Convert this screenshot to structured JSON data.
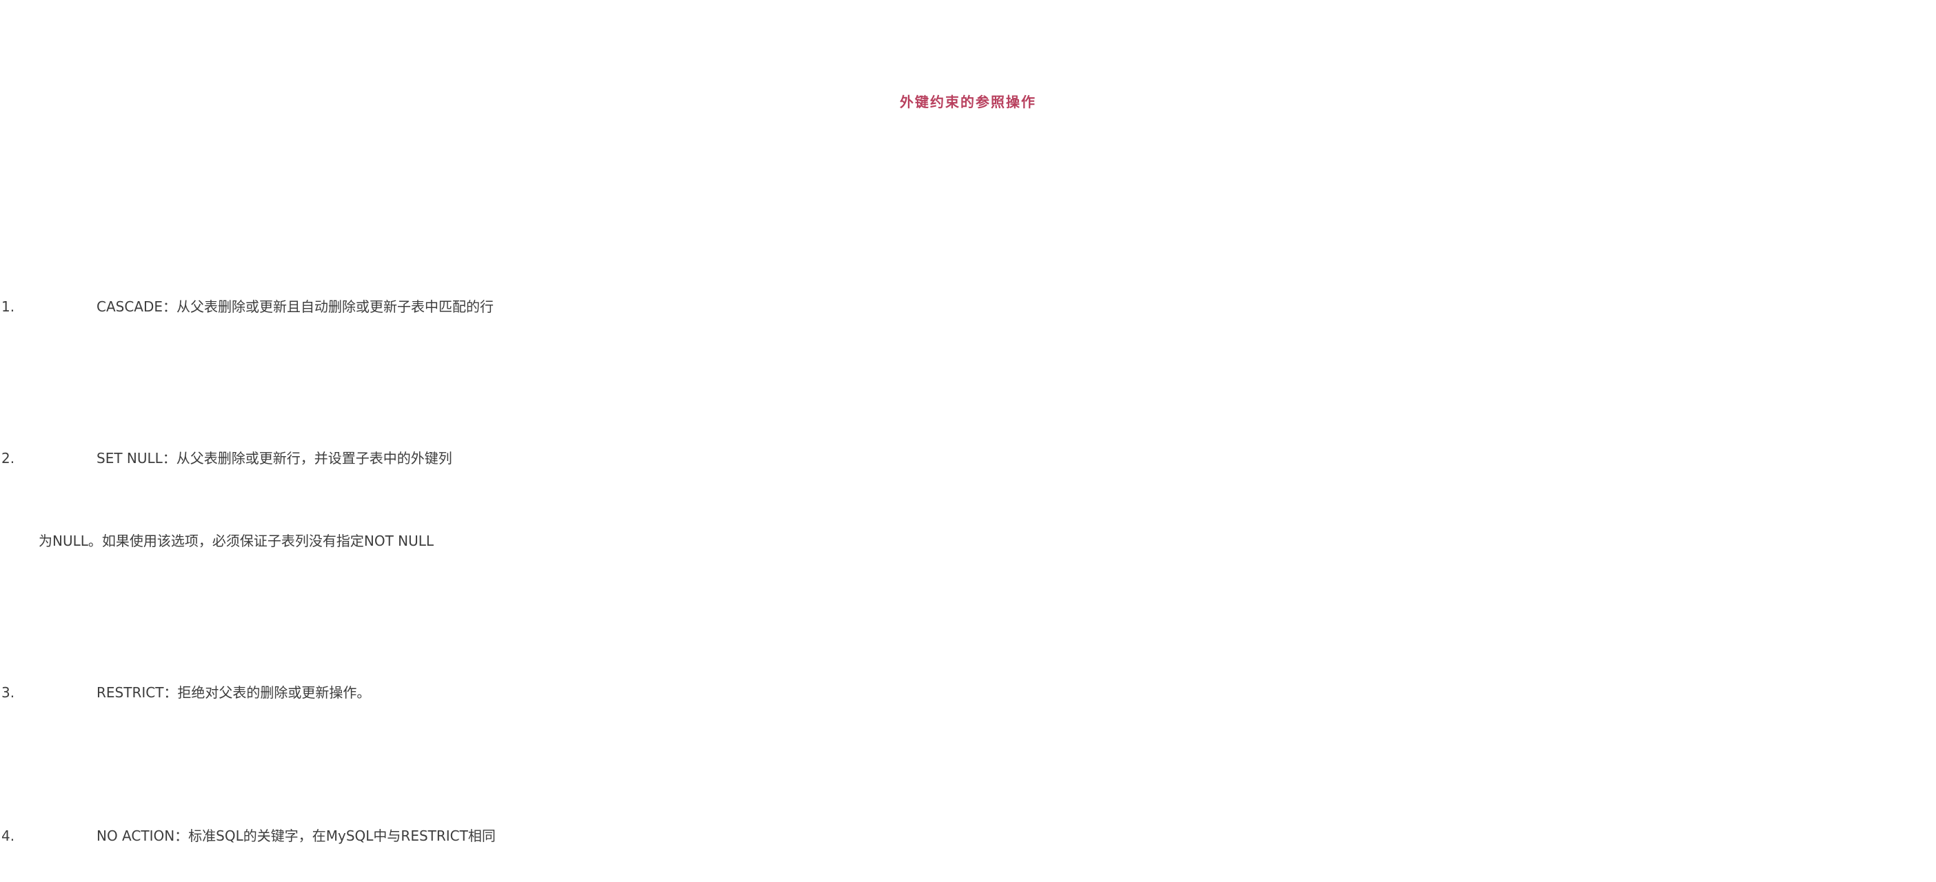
{
  "slide": {
    "title": "外键约束的参照操作",
    "items": [
      {
        "number": "1.",
        "line1": "CASCADE：从父表删除或更新且自动删除或更新子表中匹配的行"
      },
      {
        "number": "2.",
        "line1": "SET NULL：从父表删除或更新行，并设置子表中的外键列",
        "line2": "为NULL。如果使用该选项，必须保证子表列没有指定NOT NULL"
      },
      {
        "number": "3.",
        "line1": "RESTRICT：拒绝对父表的删除或更新操作。"
      },
      {
        "number": "4.",
        "line1": "NO ACTION：标准SQL的关键字，在MySQL中与RESTRICT相同"
      }
    ],
    "colors": {
      "title": "#b8405e",
      "body_text": "#3d3d3d",
      "background": "#ffffff"
    }
  }
}
